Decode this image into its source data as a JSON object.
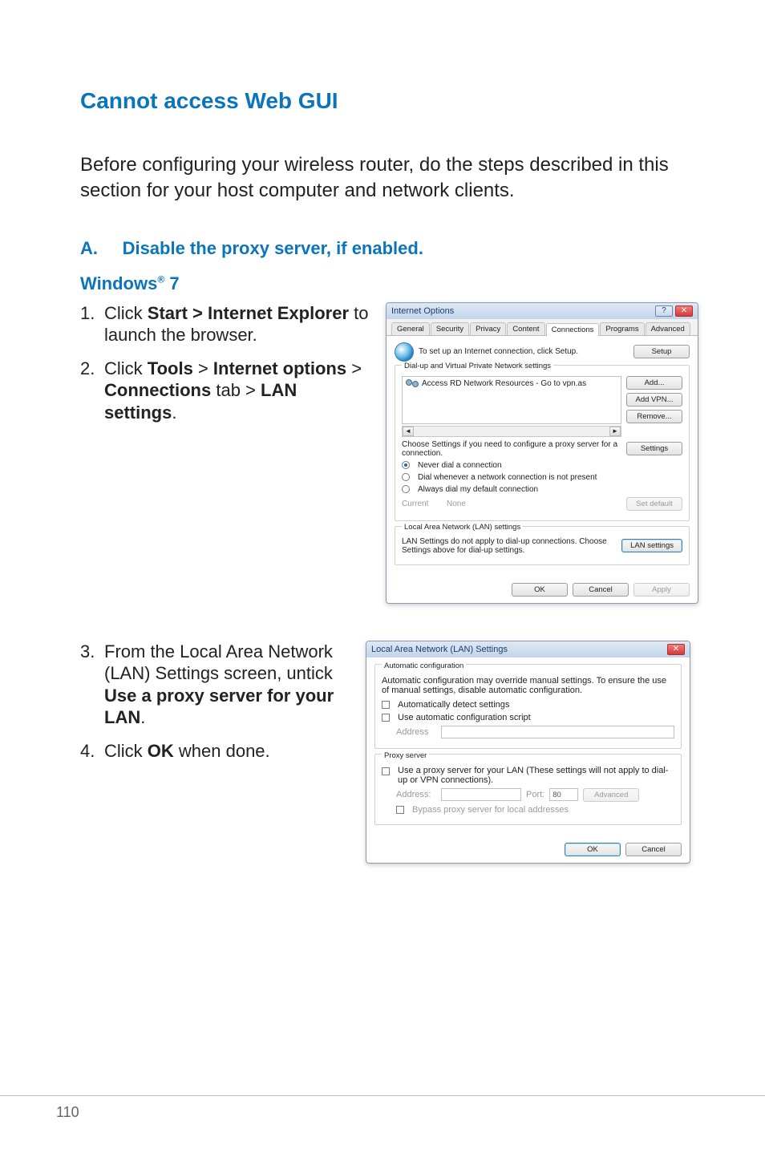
{
  "heading": "Cannot access Web GUI",
  "intro": "Before configuring your wireless router, do the steps described in this section for your host computer and network clients.",
  "section_a_prefix": "A.",
  "section_a_text": "Disable the proxy server, if enabled.",
  "windows_label": "Windows",
  "windows_sup": "®",
  "windows_ver": " 7",
  "steps_top": {
    "s1_pre": "Click ",
    "s1_bold": "Start > Internet Explorer",
    "s1_post": " to launch the browser.",
    "s2_pre": "Click ",
    "s2_b1": "Tools",
    "s2_gt1": " > ",
    "s2_b2": "Internet options",
    "s2_gt2": " > ",
    "s2_b3": "Connections",
    "s2_mid": " tab > ",
    "s2_b4": "LAN settings",
    "s2_end": "."
  },
  "steps_bottom": {
    "s3_pre": "From the Local Area Network (LAN) Settings screen, untick ",
    "s3_bold": "Use a proxy server for your LAN",
    "s3_end": ".",
    "s4_pre": "Click ",
    "s4_bold": "OK",
    "s4_end": " when done."
  },
  "io": {
    "title": "Internet Options",
    "tabs": [
      "General",
      "Security",
      "Privacy",
      "Content",
      "Connections",
      "Programs",
      "Advanced"
    ],
    "active_tab": 4,
    "setup_text": "To set up an Internet connection, click Setup.",
    "setup_btn": "Setup",
    "dialup_legend": "Dial-up and Virtual Private Network settings",
    "vpn_item": "Access RD Network Resources - Go to vpn.as",
    "add_btn": "Add...",
    "addvpn_btn": "Add VPN...",
    "remove_btn": "Remove...",
    "choose_text": "Choose Settings if you need to configure a proxy server for a connection.",
    "settings_btn": "Settings",
    "r_never": "Never dial a connection",
    "r_whenever": "Dial whenever a network connection is not present",
    "r_always": "Always dial my default connection",
    "current_lbl": "Current",
    "current_val": "None",
    "setdefault_btn": "Set default",
    "lan_legend": "Local Area Network (LAN) settings",
    "lan_text": "LAN Settings do not apply to dial-up connections. Choose Settings above for dial-up settings.",
    "lan_btn": "LAN settings",
    "ok": "OK",
    "cancel": "Cancel",
    "apply": "Apply"
  },
  "lan": {
    "title": "Local Area Network (LAN) Settings",
    "auto_legend": "Automatic configuration",
    "auto_text": "Automatic configuration may override manual settings.  To ensure the use of manual settings, disable automatic configuration.",
    "auto_detect": "Automatically detect settings",
    "auto_script": "Use automatic configuration script",
    "address_lbl": "Address",
    "proxy_legend": "Proxy server",
    "proxy_use": "Use a proxy server for your LAN (These settings will not apply to dial-up or VPN connections).",
    "addr_lbl": "Address:",
    "port_lbl": "Port:",
    "port_val": "80",
    "advanced_btn": "Advanced",
    "bypass": "Bypass proxy server for local addresses",
    "ok": "OK",
    "cancel": "Cancel"
  },
  "page_number": "110"
}
